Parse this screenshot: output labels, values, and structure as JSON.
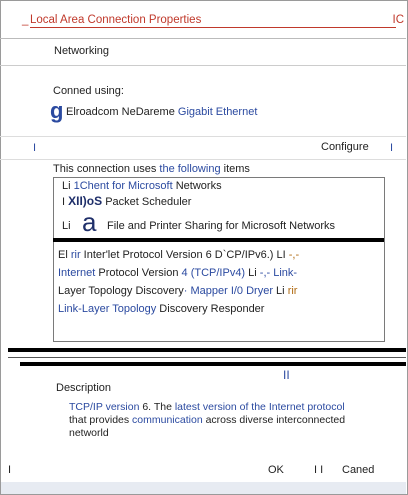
{
  "window": {
    "title_prefix": "_",
    "title": "Local Area Connection Properties",
    "title_right": "IC"
  },
  "tab": {
    "label": "Networking"
  },
  "connect_using": {
    "label": "Conned using:",
    "adapter_glyph": "g",
    "adapter_part1": "Elroadcom NeDareme",
    "adapter_part2": "Gigabit Ethernet"
  },
  "configure": {
    "left_mark": "I",
    "label": "Configure",
    "right_mark": "I"
  },
  "items": {
    "heading_part1": "This connection uses",
    "heading_part2": "the following",
    "heading_part3": "items",
    "rows": [
      {
        "prefix": "Li",
        "text_blue": "1Chent for Microsoft",
        "text_dark": "Networks"
      },
      {
        "prefix": "I",
        "text_bold": "XII)oS",
        "text_dark": "Packet Scheduler"
      },
      {
        "prefix": "Li",
        "glyph": "a",
        "text_dark": "File and Printer Sharing for Microsoft Networks"
      }
    ],
    "protocol_lines": [
      {
        "parts": [
          {
            "t": "El ",
            "c": "dark"
          },
          {
            "t": "rir",
            "c": "blue"
          },
          {
            "t": " Inter'let Protocol Version 6 D`CP/IPv6.) LI ",
            "c": "dark"
          },
          {
            "t": "-,-",
            "c": "orange"
          }
        ]
      },
      {
        "parts": [
          {
            "t": "Internet",
            "c": "blue"
          },
          {
            "t": " Protocol Version ",
            "c": "dark"
          },
          {
            "t": "4 (TCP/IPv4)",
            "c": "blue"
          },
          {
            "t": " Li ",
            "c": "dark"
          },
          {
            "t": "-,- Link-",
            "c": "blue"
          }
        ]
      },
      {
        "parts": [
          {
            "t": "Layer Topology Discovery",
            "c": "dark"
          },
          {
            "t": "· Mapper I/0 Dryer",
            "c": "blue"
          },
          {
            "t": " Li ",
            "c": "dark"
          },
          {
            "t": "rir",
            "c": "orange"
          }
        ]
      },
      {
        "parts": [
          {
            "t": "Link-Layer Topology",
            "c": "blue"
          },
          {
            "t": " Discovery Responder",
            "c": "dark"
          }
        ]
      }
    ]
  },
  "mid_mark": "II",
  "description": {
    "heading": "Description",
    "line1_parts": [
      {
        "t": "TCP/IP version ",
        "c": "blue"
      },
      {
        "t": "6. The",
        "c": "dark"
      },
      {
        "t": " latest version of the ",
        "c": "blue"
      },
      {
        "t": "Internet protocol",
        "c": "blue"
      }
    ],
    "line2_parts": [
      {
        "t": "that provides ",
        "c": "dark"
      },
      {
        "t": "communication",
        "c": "blue"
      },
      {
        "t": " across diverse interconnected",
        "c": "dark"
      }
    ],
    "line3": "networld"
  },
  "buttons": {
    "left_mark": "I",
    "ok": "OK",
    "sep": "I I",
    "cancel": "Caned"
  }
}
